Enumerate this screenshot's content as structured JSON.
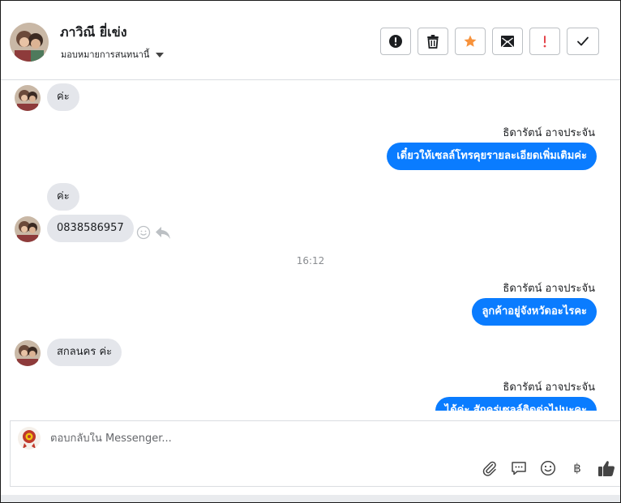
{
  "header": {
    "contact_name": "ภาวิณี ยี่เข่ง",
    "assign_label": "มอบหมายการสนทนานี้",
    "actions": [
      {
        "name": "spam-button",
        "icon": "alert-circle-icon"
      },
      {
        "name": "delete-button",
        "icon": "trash-icon"
      },
      {
        "name": "star-button",
        "icon": "star-icon",
        "color": "#f7923b"
      },
      {
        "name": "mark-unread-button",
        "icon": "envelope-icon"
      },
      {
        "name": "follow-up-button",
        "icon": "exclamation-icon",
        "color": "#e4464c"
      },
      {
        "name": "done-button",
        "icon": "check-icon"
      }
    ]
  },
  "thread": {
    "msg1": "ค่ะ",
    "sender1": "ธิดารัตน์ อาจประจัน",
    "msg2": "เดี๋ยวให้เซลล์โทรคุยรายละเอียดเพิ่มเติมค่ะ",
    "msg3": "ค่ะ",
    "msg4": "0838586957",
    "timestamp": "16:12",
    "sender2": "ธิดารัตน์ อาจประจัน",
    "msg5": "ลูกค้าอยู่จังหวัดอะไรคะ",
    "msg6": "สกลนคร ค่ะ",
    "sender3": "ธิดารัตน์ อาจประจัน",
    "msg7": "ได้ค่ะ สักครู่เซลล์ติดต่อไปนะคะ"
  },
  "composer": {
    "placeholder": "ตอบกลับใน Messenger...",
    "currency_symbol": "฿"
  },
  "colors": {
    "accent": "#0a7cff",
    "incoming_bubble": "#e4e6eb",
    "star": "#f7923b",
    "warning": "#e4464c"
  }
}
